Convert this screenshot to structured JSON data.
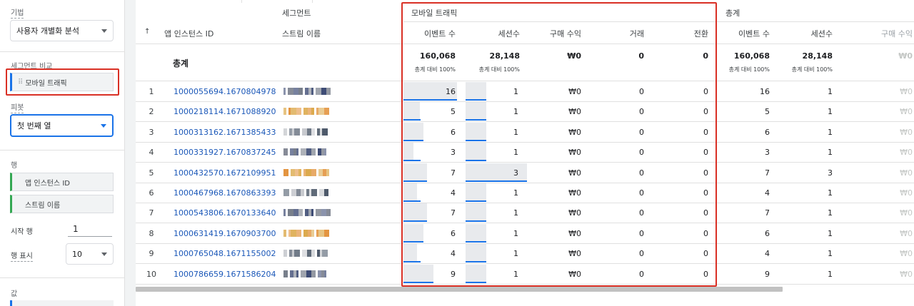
{
  "sidebar": {
    "technique_label": "기법",
    "technique_value": "사용자 개별화 분석",
    "segment_compare_label": "세그먼트 비교",
    "segment_chip": "모바일 트래픽",
    "pivot_label": "피봇",
    "pivot_value": "첫 번째 열",
    "rows_label": "행",
    "row_chips": [
      "앱 인스턴스 ID",
      "스트림 이름"
    ],
    "start_row_label": "시작 행",
    "start_row_value": "1",
    "show_rows_label": "행 표시",
    "show_rows_value": "10",
    "values_label": "값"
  },
  "table": {
    "group_headers": {
      "segment": "세그먼트",
      "mobile": "모바일 트래픽",
      "total": "총계"
    },
    "sort_icon": "↑",
    "columns": {
      "app_instance_id": "앱 인스턴스 ID",
      "stream_name": "스트림 이름",
      "mobile": [
        "이벤트 수",
        "세션수",
        "구매 수익",
        "거래",
        "전환"
      ],
      "total": [
        "이벤트 수",
        "세션수",
        "구매 수익"
      ]
    },
    "totals": {
      "label": "총계",
      "mobile": [
        "160,068",
        "28,148",
        "₩0",
        "0",
        "0"
      ],
      "mobile_sub": [
        "총계 대비 100%",
        "총계 대비 100%"
      ],
      "total": [
        "160,068",
        "28,148",
        "₩0"
      ],
      "total_sub": [
        "총계 대비 100%",
        "총계 대비 100%"
      ]
    },
    "rows": [
      {
        "n": "1",
        "id": "1000055694.1670804978",
        "events": "16",
        "sessions": "1",
        "revenue": "₩0",
        "tx": "0",
        "conv": "0",
        "t_events": "16",
        "t_sessions": "1",
        "t_revenue": "₩0",
        "ev_ratio": 1.0,
        "se_ratio": 0.333
      },
      {
        "n": "2",
        "id": "1000218114.1671088920",
        "events": "5",
        "sessions": "1",
        "revenue": "₩0",
        "tx": "0",
        "conv": "0",
        "t_events": "5",
        "t_sessions": "1",
        "t_revenue": "₩0",
        "ev_ratio": 0.3125,
        "se_ratio": 0.333
      },
      {
        "n": "3",
        "id": "1000313162.1671385433",
        "events": "6",
        "sessions": "1",
        "revenue": "₩0",
        "tx": "0",
        "conv": "0",
        "t_events": "6",
        "t_sessions": "1",
        "t_revenue": "₩0",
        "ev_ratio": 0.375,
        "se_ratio": 0.333
      },
      {
        "n": "4",
        "id": "1000331927.1670837245",
        "events": "3",
        "sessions": "1",
        "revenue": "₩0",
        "tx": "0",
        "conv": "0",
        "t_events": "3",
        "t_sessions": "1",
        "t_revenue": "₩0",
        "ev_ratio": 0.1875,
        "se_ratio": 0.333
      },
      {
        "n": "5",
        "id": "1000432570.1672109951",
        "events": "7",
        "sessions": "3",
        "revenue": "₩0",
        "tx": "0",
        "conv": "0",
        "t_events": "7",
        "t_sessions": "3",
        "t_revenue": "₩0",
        "ev_ratio": 0.4375,
        "se_ratio": 1.0
      },
      {
        "n": "6",
        "id": "1000467968.1670863393",
        "events": "4",
        "sessions": "1",
        "revenue": "₩0",
        "tx": "0",
        "conv": "0",
        "t_events": "4",
        "t_sessions": "1",
        "t_revenue": "₩0",
        "ev_ratio": 0.25,
        "se_ratio": 0.333
      },
      {
        "n": "7",
        "id": "1000543806.1670133640",
        "events": "7",
        "sessions": "1",
        "revenue": "₩0",
        "tx": "0",
        "conv": "0",
        "t_events": "7",
        "t_sessions": "1",
        "t_revenue": "₩0",
        "ev_ratio": 0.4375,
        "se_ratio": 0.333
      },
      {
        "n": "8",
        "id": "1000631419.1670903700",
        "events": "6",
        "sessions": "1",
        "revenue": "₩0",
        "tx": "0",
        "conv": "0",
        "t_events": "6",
        "t_sessions": "1",
        "t_revenue": "₩0",
        "ev_ratio": 0.375,
        "se_ratio": 0.333
      },
      {
        "n": "9",
        "id": "1000765048.1671155002",
        "events": "4",
        "sessions": "1",
        "revenue": "₩0",
        "tx": "0",
        "conv": "0",
        "t_events": "4",
        "t_sessions": "1",
        "t_revenue": "₩0",
        "ev_ratio": 0.25,
        "se_ratio": 0.333
      },
      {
        "n": "10",
        "id": "1000786659.1671586204",
        "events": "9",
        "sessions": "1",
        "revenue": "₩0",
        "tx": "0",
        "conv": "0",
        "t_events": "9",
        "t_sessions": "1",
        "t_revenue": "₩0",
        "ev_ratio": 0.5625,
        "se_ratio": 0.333
      }
    ]
  },
  "colors": {
    "accent": "#1a73e8",
    "highlight_border": "#d93025",
    "link": "#1a57b8",
    "bar_fill": "#e8eaed"
  }
}
